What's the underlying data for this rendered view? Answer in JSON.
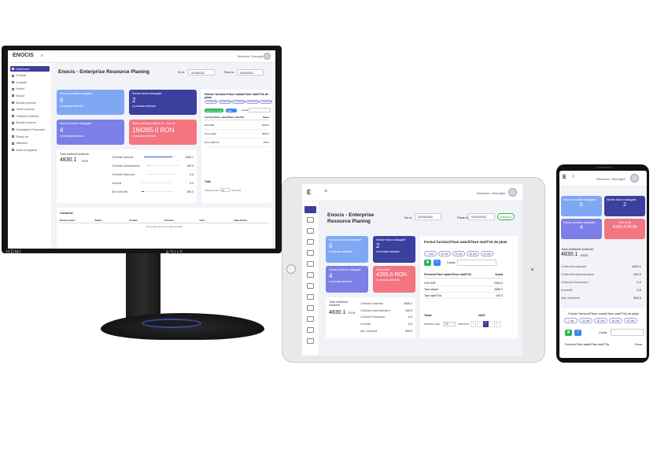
{
  "app": {
    "brand": "ENOCIS",
    "welcome": "Welcome, Gheorghe",
    "title": "Enocis - Enterprise Resource Planing",
    "date_from_label": "De la",
    "date_from": "01/04/2022",
    "date_to_label": "Pana la",
    "date_to": "03/10/2022",
    "apply_label": "Afiseaza"
  },
  "sidebar": {
    "items": [
      {
        "label": "Dashboard",
        "icon": "grid-icon"
      },
      {
        "label": "Proiecte",
        "icon": "folder-icon"
      },
      {
        "label": "Contacte",
        "icon": "contacts-icon"
      },
      {
        "label": "Facturi",
        "icon": "invoice-icon"
      },
      {
        "label": "Stocuri",
        "icon": "stock-icon"
      },
      {
        "label": "Situatie proiecte",
        "icon": "chart-icon"
      },
      {
        "label": "Oferte proiecte",
        "icon": "offer-icon"
      },
      {
        "label": "Cheltuieli indirecte",
        "icon": "expense-icon"
      },
      {
        "label": "Situatie furnizori",
        "icon": "supplier-icon"
      },
      {
        "label": "Centralizare Financiare",
        "icon": "finance-icon"
      },
      {
        "label": "Pontaj ore",
        "icon": "clock-icon"
      },
      {
        "label": "Utilizatori",
        "icon": "users-icon"
      },
      {
        "label": "Istoric inregistrari",
        "icon": "history-icon"
      }
    ]
  },
  "stats": [
    {
      "label": "Numar contacte adaugate",
      "value": "6",
      "sub": "In perioada selectata",
      "color": "#7fa7f4"
    },
    {
      "label": "Numar facturi adaugate",
      "value": "2",
      "sub": "In perioada selectata",
      "color": "#3b3f9e"
    },
    {
      "label": "Numar proiecte adaugate",
      "value": "4",
      "sub": "In perioada selectata",
      "color": "#7b7fe6"
    },
    {
      "label": "Total profit",
      "value": "4265.0 RON",
      "sub": "In perioada selectata",
      "color": "#f27580"
    }
  ],
  "monitor_stats": [
    {
      "label": "Numar contacte adaugate",
      "value": "6",
      "sub": "In perioada selectata"
    },
    {
      "label": "Numar facturi adaugate",
      "value": "2",
      "sub": "In perioada selectata"
    },
    {
      "label": "Numar proiecte adaugate",
      "value": "4",
      "sub": "In perioada selectata"
    },
    {
      "label": "Total profit fara proiecte noi - fara cfx",
      "value": "184265.0 RON",
      "sub": "In perioada selectata"
    }
  ],
  "expenses": {
    "title": "Total cheltuieli indirecte",
    "total": "4830.1",
    "currency": "RON",
    "rows": [
      {
        "label": "Cheltuieli salariale",
        "value": "4430.1",
        "fill": 0.92
      },
      {
        "label": "Cheltuieli administrative",
        "value": "100.0",
        "fill": 0.03
      },
      {
        "label": "Cheltuieli financiare",
        "value": "0.0",
        "fill": 0
      },
      {
        "label": "Investitii",
        "value": "0.0",
        "fill": 0
      },
      {
        "label": "Alte cheltuieli",
        "value": "300.0",
        "fill": 0.07
      }
    ]
  },
  "invoices": {
    "title": "Facturi furnizori/Taxe salarii/Taxe stat/TVA de plata",
    "periods": [
      "7 zile",
      "15 zile",
      "30 zile",
      "45 zile",
      "60 zile"
    ],
    "monitor_periods": [
      "Urmatoarele 7 zile",
      "Urmatoarele 15 zile",
      "Urmatoarele 30 zile",
      "Urmatoarele 45 zile",
      "Urmatoarele 60 zile"
    ],
    "export_label": "Exporta in excel",
    "filter_label": "Filtre",
    "search_label": "Cauta:",
    "col_name": "Furnizori/Taxe salarii/Taxe stat/TVA",
    "col_sum": "Suma",
    "rows": [
      {
        "name": "HOLVER",
        "sum": "2000.0"
      },
      {
        "name": "Taxe salarii",
        "sum": "2560.0"
      },
      {
        "name": "Taxe stat/TVA",
        "sum": "100.0"
      }
    ],
    "total_label": "Total:",
    "total_value": "2600",
    "show_label": "Afiseaza rata",
    "show_value": "10",
    "per_page_label": "elemente",
    "page_current": "1"
  },
  "contracts": {
    "title": "Comenzi",
    "columns": [
      "Nume proiect",
      "Status",
      "Produs",
      "Furnizor",
      "Cant.",
      "Data livrare"
    ],
    "empty": "No exista comenzi in baza de date"
  },
  "devices": {
    "monitor_model": "HDMI",
    "monitor_brand": "ASUS"
  }
}
